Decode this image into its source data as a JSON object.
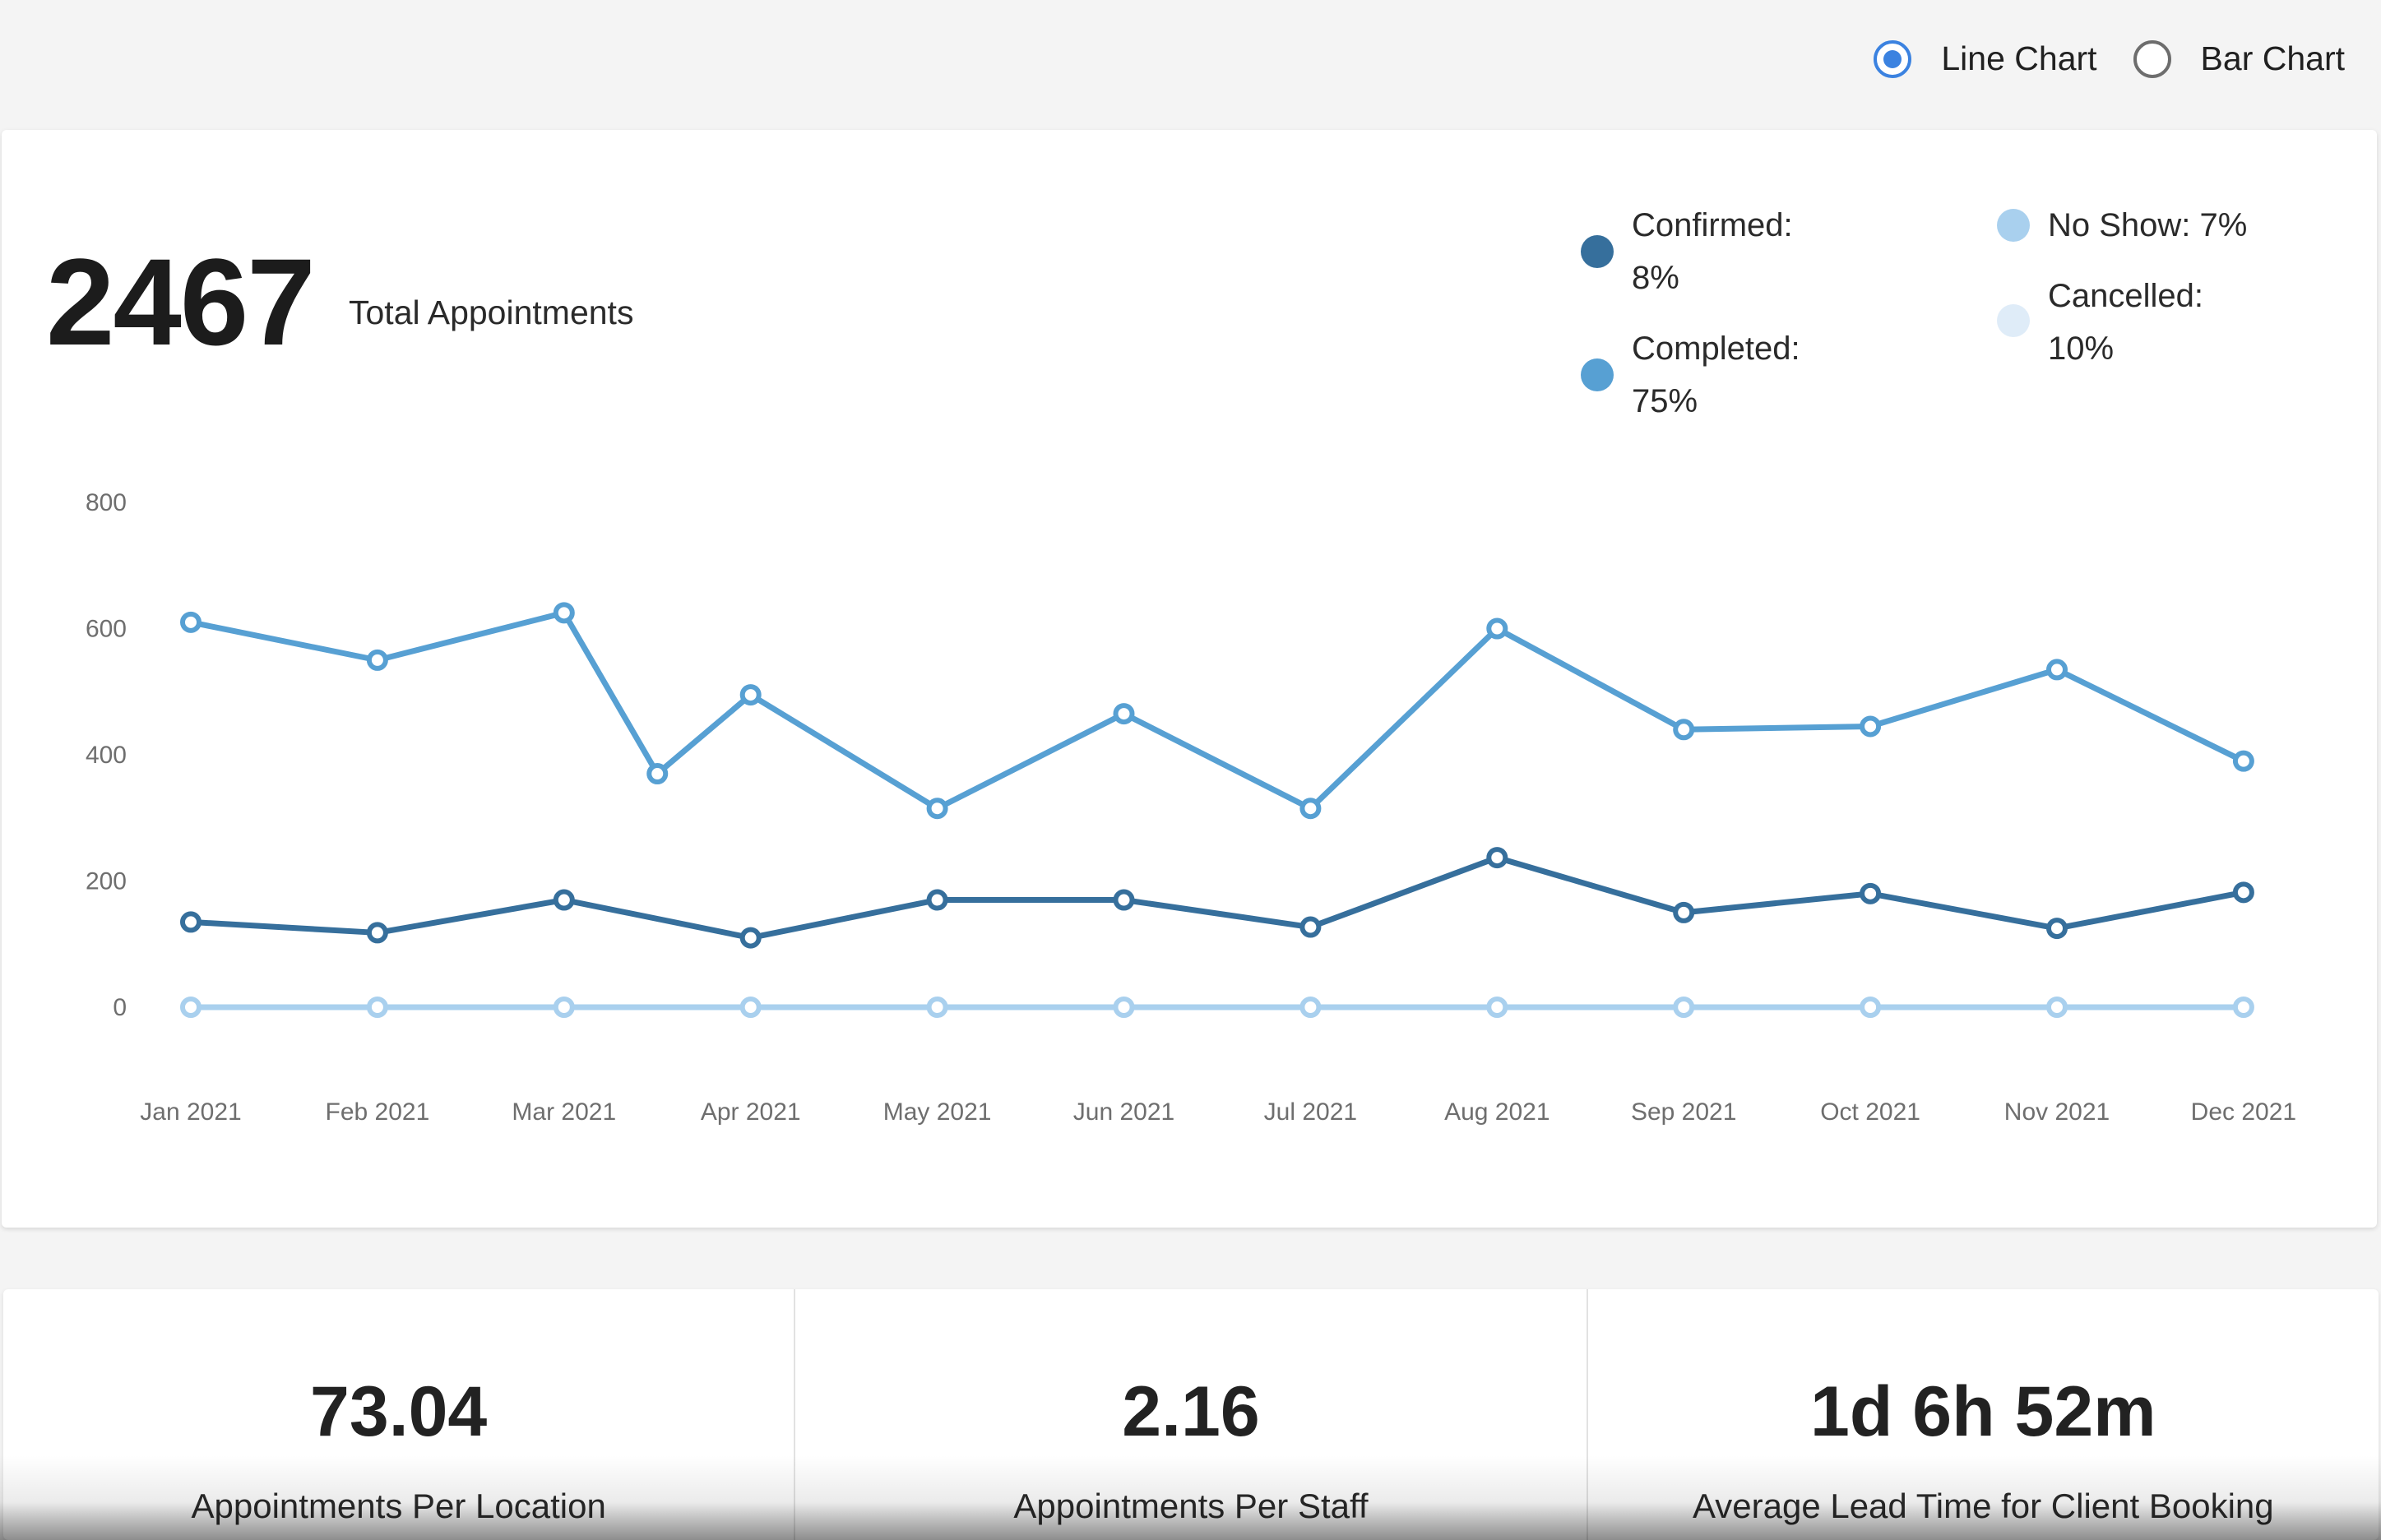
{
  "view_toggle": {
    "options": [
      {
        "label": "Line Chart",
        "checked": true
      },
      {
        "label": "Bar Chart",
        "checked": false
      }
    ]
  },
  "summary": {
    "total_value": "2467",
    "total_label": "Total Appointments"
  },
  "legend": [
    {
      "label": "Confirmed:",
      "value": "8%",
      "color": "#366f9c"
    },
    {
      "label": "Completed:",
      "value": "75%",
      "color": "#57a0d3"
    },
    {
      "label": "No Show: 7%",
      "value": "",
      "color": "#a9d0ee"
    },
    {
      "label": "Cancelled:",
      "value": "10%",
      "color": "#dfecf8"
    }
  ],
  "chart_data": {
    "type": "line",
    "categories": [
      "Jan 2021",
      "Feb 2021",
      "Mar 2021",
      "Apr 2021",
      "May 2021",
      "Jun 2021",
      "Jul 2021",
      "Aug 2021",
      "Sep 2021",
      "Oct 2021",
      "Nov 2021",
      "Dec 2021"
    ],
    "y_ticks": [
      "800",
      "600",
      "400",
      "200",
      "0"
    ],
    "ylim": [
      0,
      800
    ],
    "grid": false,
    "series": [
      {
        "name": "Completed",
        "color": "#57a0d3",
        "x": [
          0,
          1,
          2,
          2.5,
          3,
          4,
          5,
          6,
          7,
          8,
          9,
          10,
          11
        ],
        "values": [
          610,
          550,
          625,
          370,
          495,
          315,
          465,
          315,
          600,
          440,
          445,
          535,
          390
        ]
      },
      {
        "name": "Confirmed",
        "color": "#366f9c",
        "x": [
          0,
          1,
          2,
          3,
          4,
          5,
          6,
          7,
          8,
          9,
          10,
          11
        ],
        "values": [
          135,
          118,
          170,
          110,
          170,
          170,
          127,
          237,
          150,
          180,
          125,
          182
        ]
      },
      {
        "name": "No Show",
        "color": "#a9d0ee",
        "x": [
          0,
          1,
          2,
          3,
          4,
          5,
          6,
          7,
          8,
          9,
          10,
          11
        ],
        "values": [
          0,
          0,
          0,
          0,
          0,
          0,
          0,
          0,
          0,
          0,
          0,
          0
        ]
      }
    ]
  },
  "stats": [
    {
      "value": "73.04",
      "label": "Appointments Per Location"
    },
    {
      "value": "2.16",
      "label": "Appointments Per Staff"
    },
    {
      "value": "1d 6h 52m",
      "label": "Average Lead Time for Client Booking"
    }
  ]
}
